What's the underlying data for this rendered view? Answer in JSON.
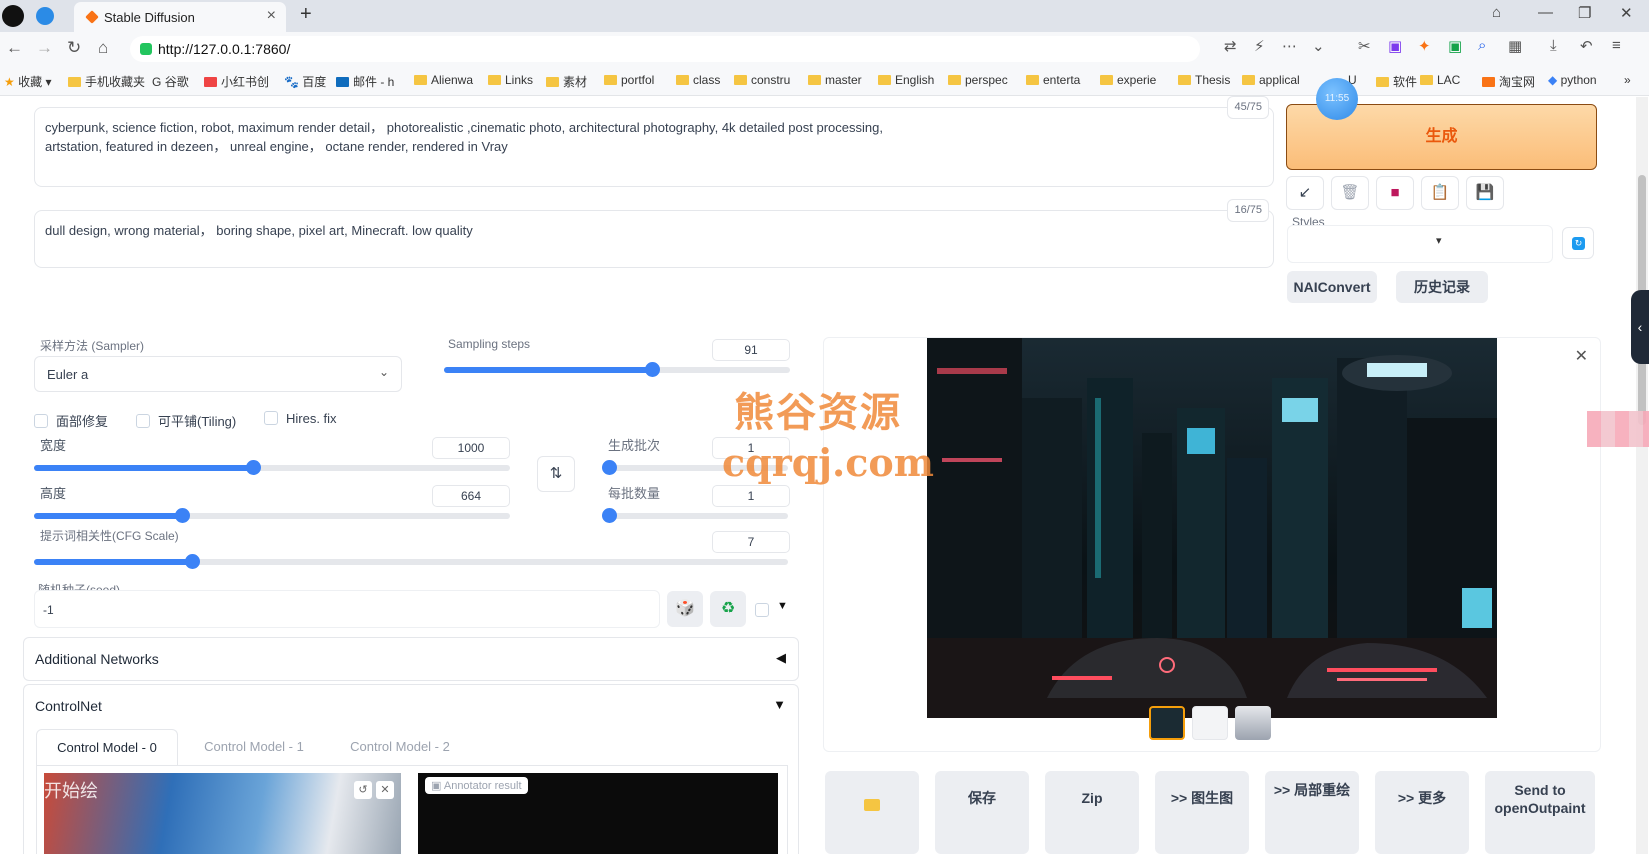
{
  "browser": {
    "tab_title": "Stable Diffusion",
    "url": "http://127.0.0.1:7860/",
    "bookmarks": [
      "收藏",
      "手机收藏夹",
      "谷歌",
      "小红书创",
      "百度",
      "邮件 - h",
      "Alienwa",
      "Links",
      "素材",
      "portfol",
      "class",
      "constru",
      "master",
      "English",
      "perspec",
      "enterta",
      "experie",
      "Thesis",
      "applical",
      "U",
      "软件",
      "LAC",
      "淘宝网",
      "python"
    ],
    "clock": "11:55"
  },
  "prompt": {
    "positive": "cyberpunk, science fiction, robot, maximum render detail， photorealistic ,cinematic photo, architectural photography, 4k detailed post processing,\nartstation, featured in dezeen， unreal engine， octane render, rendered in Vray",
    "positive_count": "45/75",
    "negative": "dull design, wrong material， boring shape, pixel art, Minecraft. low quality",
    "negative_count": "16/75"
  },
  "actions": {
    "generate_label": "生成",
    "styles_label": "Styles",
    "naiconvert_label": "NAIConvert",
    "history_label": "历史记录"
  },
  "params": {
    "sampler_label": "采样方法 (Sampler)",
    "sampler_value": "Euler a",
    "steps_label": "Sampling steps",
    "steps_value": "91",
    "steps_fraction": 0.6,
    "face_restore": "面部修复",
    "tiling": "可平铺(Tiling)",
    "hires": "Hires. fix",
    "width_label": "宽度",
    "width_value": "1000",
    "width_fraction": 0.46,
    "height_label": "高度",
    "height_value": "664",
    "height_fraction": 0.31,
    "batch_count_label": "生成批次",
    "batch_count_value": "1",
    "batch_size_label": "每批数量",
    "batch_size_value": "1",
    "cfg_label": "提示词相关性(CFG Scale)",
    "cfg_value": "7",
    "cfg_fraction": 0.21,
    "seed_label": "随机种子(seed)",
    "seed_value": "-1"
  },
  "sections": {
    "additional_networks": "Additional Networks",
    "controlnet": "ControlNet",
    "tabs": [
      "Control Model - 0",
      "Control Model - 1",
      "Control Model - 2"
    ],
    "annotator": "Annotator result",
    "thumb_overlay": "开始绘"
  },
  "output": {
    "buttons": [
      "保存",
      "Zip",
      ">> 图生图",
      ">> 局部重绘",
      ">> 更多",
      "Send to openOutpaint"
    ]
  },
  "watermark": {
    "line1": "熊谷资源",
    "line2": "cqrqj.com"
  },
  "colors": {
    "accent": "#3b82f6",
    "generate_bg": "#fbbd78",
    "generate_text": "#ea580c"
  }
}
